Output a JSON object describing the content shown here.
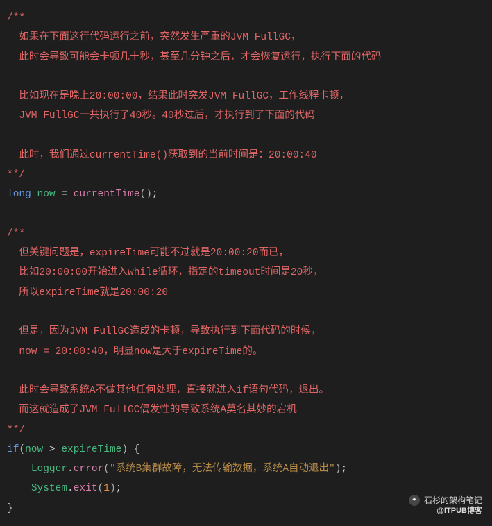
{
  "code": {
    "c1": "/**",
    "c2": "  如果在下面这行代码运行之前，突然发生严重的JVM FullGC，",
    "c3": "  此时会导致可能会卡顿几十秒，甚至几分钟之后，才会恢复运行，执行下面的代码",
    "c4": "  比如现在是晚上20:00:00，结果此时突发JVM FullGC，工作线程卡顿，",
    "c5": "  JVM FullGC一共执行了40秒。40秒过后，才执行到了下面的代码",
    "c6": "  此时，我们通过currentTime()获取到的当前时间是：20:00:40",
    "c7": "**/",
    "kw_long": "long",
    "var_now": "now",
    "op_eq": " = ",
    "fn_currentTime": "currentTime",
    "parens_empty": "()",
    "semi": ";",
    "c8": "/**",
    "c9": "  但关键问题是，expireTime可能不过就是20:00:20而已，",
    "c10": "  比如20:00:00开始进入while循环，指定的timeout时间是20秒，",
    "c11": "  所以expireTime就是20:00:20",
    "c12": "  但是，因为JVM FullGC造成的卡顿，导致执行到下面代码的时候，",
    "c13": "  now = 20:00:40，明显now是大于expireTime的。",
    "c14": "  此时会导致系统A不做其他任何处理，直接就进入if语句代码，退出。",
    "c15": "  而这就造成了JVM FullGC偶发性的导致系统A莫名其妙的宕机",
    "c16": "**/",
    "kw_if": "if",
    "lp": "(",
    "rp": ")",
    "op_gt": " > ",
    "var_expireTime": "expireTime",
    "lbrace": " {",
    "indent": "    ",
    "cls_Logger": "Logger",
    "dot": ".",
    "fn_error": "error",
    "str_msg": "\"系统B集群故障，无法传输数据，系统A自动退出\"",
    "cls_System": "System",
    "fn_exit": "exit",
    "num_1": "1",
    "rbrace": "}"
  },
  "watermark": {
    "line1": "石杉的架构笔记",
    "line2": "@ITPUB博客"
  }
}
